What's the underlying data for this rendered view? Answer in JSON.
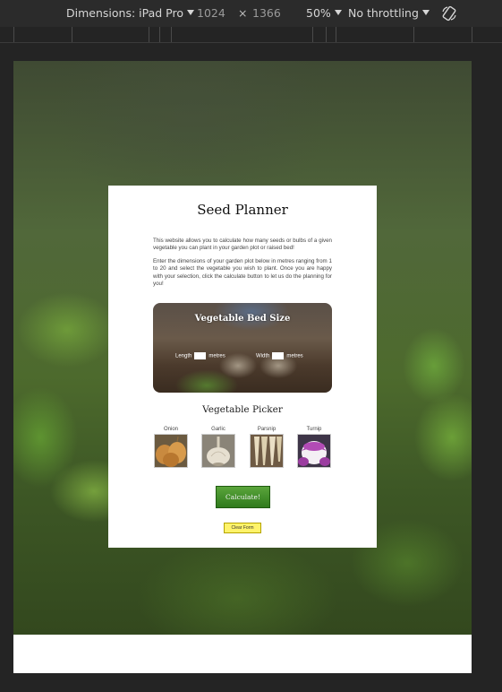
{
  "devtools": {
    "dimensions_label": "Dimensions: iPad Pro",
    "width": "1024",
    "times": "×",
    "height": "1366",
    "zoom": "50%",
    "throttling": "No throttling",
    "rotate_icon": "rotate-icon"
  },
  "page": {
    "title": "Seed Planner",
    "intro_p1": "This website allows you to calculate how many seeds or bulbs of a given vegetable you can plant in your garden plot or raised bed!",
    "intro_p2": "Enter the dimensions of your garden plot below in metres ranging from 1 to 20 and select the vegetable you wish to plant. Once you are happy with your selection, click the calculate button to let us do the planning for you!",
    "bed": {
      "title": "Vegetable Bed Size",
      "length_label": "Length",
      "width_label": "Width",
      "unit": "metres"
    },
    "picker": {
      "title": "Vegetable Picker",
      "items": [
        {
          "name": "Onion"
        },
        {
          "name": "Garlic"
        },
        {
          "name": "Parsnip"
        },
        {
          "name": "Turnip"
        }
      ]
    },
    "calculate_label": "Calculate!",
    "clear_label": "Clear Form"
  }
}
